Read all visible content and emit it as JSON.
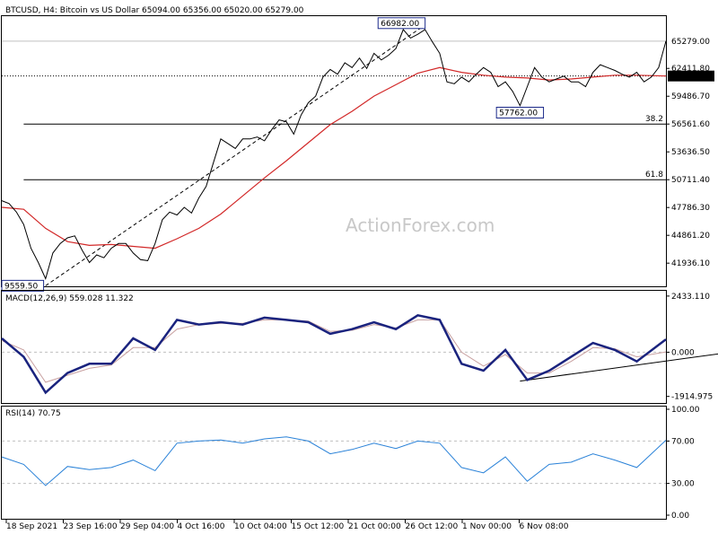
{
  "chart_data": [
    {
      "type": "line",
      "title": "BTCUSD, H4:  Bitcoin vs US Dollar  65094.00 65356.00 65020.00 65279.00",
      "watermark": "ActionForex.com",
      "ylim": [
        39500,
        68000
      ],
      "y_ticks": [
        "62411.80",
        "59486.70",
        "56561.60",
        "53636.50",
        "50711.40",
        "47786.30",
        "44861.20",
        "41936.10"
      ],
      "y_tick_values": [
        62411.8,
        59486.7,
        56561.6,
        53636.5,
        50711.4,
        47786.3,
        44861.2,
        41936.1
      ],
      "x_ticks": [
        "18 Sep 2021",
        "23 Sep 16:00",
        "29 Sep 04:00",
        "4 Oct 16:00",
        "10 Oct 04:00",
        "15 Oct 12:00",
        "21 Oct 00:00",
        "26 Oct 12:00",
        "1 Nov 00:00",
        "6 Nov 08:00"
      ],
      "price_line": {
        "value": 65279.0,
        "label": "65279.00"
      },
      "ma_line": {
        "value": 61613.0,
        "label": "61613.00"
      },
      "fib_levels": [
        {
          "label": "38.2",
          "value": 56561.6
        },
        {
          "label": "61.8",
          "value": 50711.4
        }
      ],
      "annotations": [
        {
          "label": "66982.00",
          "x": 58,
          "y": 66982
        },
        {
          "label": "57762.00",
          "x": 71,
          "y": 57762
        },
        {
          "label": "9559.50",
          "x": 6,
          "y": 39560
        }
      ],
      "trendline": {
        "x": [
          6,
          58
        ],
        "y": [
          39560,
          66982
        ]
      },
      "series": [
        {
          "name": "",
          "x": [
            0,
            1,
            2,
            3,
            4,
            5,
            6,
            7,
            8,
            9,
            10,
            11,
            12,
            13,
            14,
            15,
            16,
            17,
            18,
            19,
            20,
            21,
            22,
            23,
            24,
            25,
            26,
            27,
            28,
            29,
            30,
            31,
            32,
            33,
            34,
            35,
            36,
            37,
            38,
            39,
            40,
            41,
            42,
            43,
            44,
            45,
            46,
            47,
            48,
            49,
            50,
            51,
            52,
            53,
            54,
            55,
            56,
            57,
            58,
            59,
            60,
            61,
            62,
            63,
            64,
            65,
            66,
            67,
            68,
            69,
            70,
            71,
            72,
            73,
            74,
            75,
            76,
            77,
            78,
            79,
            80,
            81,
            82,
            83,
            84,
            85,
            86,
            87,
            88,
            89,
            90,
            91
          ],
          "values": [
            48500,
            48200,
            47300,
            46000,
            43500,
            42000,
            40300,
            43000,
            44000,
            44600,
            44800,
            43300,
            42000,
            42800,
            42500,
            43500,
            44000,
            44000,
            43000,
            42300,
            42200,
            44000,
            46500,
            47300,
            47000,
            47800,
            47200,
            48800,
            50000,
            52500,
            55000,
            54500,
            54000,
            55000,
            55000,
            55200,
            54800,
            56000,
            57000,
            56800,
            55500,
            57500,
            58800,
            59500,
            61500,
            62300,
            61800,
            63000,
            62500,
            63500,
            62400,
            64000,
            63300,
            63800,
            64500,
            66500,
            65600,
            66000,
            66500,
            65200,
            64000,
            61000,
            60800,
            61500,
            61000,
            61800,
            62500,
            62000,
            60500,
            61000,
            60000,
            58500,
            60500,
            62500,
            61500,
            61000,
            61300,
            61600,
            61000,
            61000,
            60500,
            62000,
            62800,
            62500,
            62200,
            61800,
            61500,
            62000,
            61000,
            61500,
            62500,
            65279
          ]
        },
        {
          "name": "",
          "x": [
            0,
            3,
            6,
            9,
            12,
            15,
            18,
            21,
            24,
            27,
            30,
            33,
            36,
            39,
            42,
            45,
            48,
            51,
            54,
            57,
            60,
            63,
            66,
            69,
            72,
            75,
            78,
            81,
            84,
            87,
            91
          ],
          "values": [
            47800,
            47600,
            45600,
            44200,
            43800,
            43900,
            43700,
            43500,
            44500,
            45600,
            47100,
            49000,
            50900,
            52700,
            54600,
            56500,
            57900,
            59500,
            60700,
            61900,
            62500,
            62000,
            61700,
            61500,
            61400,
            61200,
            61300,
            61500,
            61700,
            61700,
            61613
          ]
        }
      ]
    },
    {
      "type": "line",
      "title": "MACD(12,26,9) 559.028 11.322",
      "ylim": [
        -2200,
        2700
      ],
      "y_ticks": [
        "2433.110",
        "0.000",
        "-1914.975"
      ],
      "y_tick_values": [
        2433.11,
        0,
        -1914.975
      ],
      "trendline": {
        "x": [
          71,
          101
        ],
        "y": [
          -1250,
          50
        ]
      },
      "series": [
        {
          "name": "",
          "x": [
            0,
            3,
            6,
            9,
            12,
            15,
            18,
            21,
            24,
            27,
            30,
            33,
            36,
            39,
            42,
            45,
            48,
            51,
            54,
            57,
            60,
            63,
            66,
            69,
            72,
            75,
            78,
            81,
            84,
            87,
            91
          ],
          "values": [
            600,
            -200,
            -1750,
            -900,
            -500,
            -500,
            600,
            100,
            1400,
            1200,
            1300,
            1200,
            1500,
            1400,
            1300,
            800,
            1000,
            1300,
            1000,
            1600,
            1400,
            -500,
            -800,
            100,
            -1200,
            -800,
            -200,
            400,
            100,
            -400,
            559
          ]
        },
        {
          "name": "",
          "x": [
            0,
            3,
            6,
            9,
            12,
            15,
            18,
            21,
            24,
            27,
            30,
            33,
            36,
            39,
            42,
            45,
            48,
            51,
            54,
            57,
            60,
            63,
            66,
            69,
            72,
            75,
            78,
            81,
            84,
            87,
            91
          ],
          "values": [
            500,
            100,
            -1300,
            -1000,
            -700,
            -550,
            200,
            200,
            1000,
            1200,
            1250,
            1250,
            1400,
            1400,
            1350,
            900,
            950,
            1200,
            1050,
            1400,
            1400,
            0,
            -600,
            -100,
            -900,
            -900,
            -400,
            200,
            150,
            -200,
            11
          ]
        }
      ]
    },
    {
      "type": "line",
      "title": "RSI(14) 70.75",
      "ylim": [
        0,
        100
      ],
      "y_ticks": [
        "100.00",
        "70.00",
        "30.00",
        "0.00"
      ],
      "y_tick_values": [
        100,
        70,
        30,
        0
      ],
      "series": [
        {
          "name": "",
          "x": [
            0,
            3,
            6,
            9,
            12,
            15,
            18,
            21,
            24,
            27,
            30,
            33,
            36,
            39,
            42,
            45,
            48,
            51,
            54,
            57,
            60,
            63,
            66,
            69,
            72,
            75,
            78,
            81,
            84,
            87,
            91
          ],
          "values": [
            55,
            48,
            28,
            46,
            43,
            45,
            52,
            42,
            68,
            70,
            71,
            68,
            72,
            74,
            70,
            58,
            62,
            68,
            63,
            70,
            68,
            45,
            40,
            55,
            32,
            48,
            50,
            58,
            52,
            45,
            70.75
          ]
        }
      ]
    }
  ]
}
